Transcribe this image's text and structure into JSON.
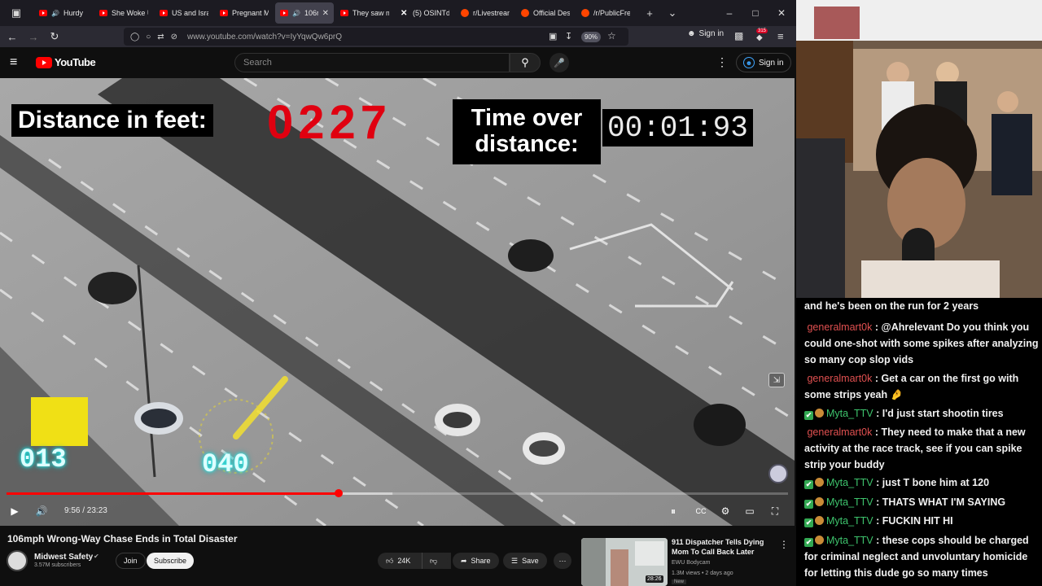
{
  "browser": {
    "tabs": [
      {
        "label": "Hurdy",
        "favicon": "youtube",
        "muted_icon": true,
        "active": false
      },
      {
        "label": "She Woke U",
        "favicon": "youtube",
        "active": false
      },
      {
        "label": "US and Isra",
        "favicon": "youtube",
        "active": false
      },
      {
        "label": "Pregnant M",
        "favicon": "youtube",
        "active": false
      },
      {
        "label": "106r",
        "favicon": "youtube",
        "muted_icon": true,
        "active": true
      },
      {
        "label": "They saw m",
        "favicon": "youtube",
        "active": false
      },
      {
        "label": "(5) OSINTde",
        "favicon": "x",
        "active": false
      },
      {
        "label": "r/Livestrean",
        "favicon": "reddit",
        "active": false
      },
      {
        "label": "Official Des",
        "favicon": "reddit",
        "active": false
      },
      {
        "label": "/r/PublicFre",
        "favicon": "reddit",
        "active": false
      }
    ],
    "url": "www.youtube.com/watch?v=IyYqwQw6prQ",
    "zoom": "90%",
    "signin_label": "Sign in",
    "extension_badge": "315"
  },
  "youtube": {
    "logo_text": "YouTube",
    "search_placeholder": "Search",
    "signin_label": "Sign in",
    "video": {
      "overlay_distance_label": "Distance in feet:",
      "overlay_distance_value": "0227",
      "overlay_time_label": "Time over distance:",
      "overlay_time_value": "00:01:93",
      "speed_left": "013",
      "speed_right": "040",
      "time_display": "9:56 / 23:23",
      "progress_fraction": 0.425,
      "buffered_fraction": 0.494
    },
    "title": "106mph Wrong-Way Chase Ends in Total Disaster",
    "channel": {
      "name": "Midwest Safety",
      "subscribers": "3.57M subscribers",
      "join_label": "Join",
      "subscribe_label": "Subscribe"
    },
    "actions": {
      "likes": "24K",
      "share_label": "Share",
      "save_label": "Save"
    },
    "suggested": {
      "title": "911 Dispatcher Tells Dying Mom To Call Back Later",
      "channel": "EWU Bodycam",
      "meta": "1.3M views • 2 days ago",
      "badge": "New",
      "duration": "28:26"
    }
  },
  "chat": {
    "lines": [
      {
        "user": "",
        "text": "and he's been on the run for 2 years"
      },
      {
        "user": "generalmart0k",
        "badges": false,
        "text": "@Ahrelevant Do you think you could one-shot with some spikes after analyzing so many cop slop vids"
      },
      {
        "user": "generalmart0k",
        "badges": false,
        "text": "Get a car on the first go with some strips yeah 🤌"
      },
      {
        "user": "Myta_TTV",
        "badges": true,
        "text": "I'd just start shootin tires"
      },
      {
        "user": "generalmart0k",
        "badges": false,
        "text": "They need to make that a new activity at the race track, see if you can spike strip your buddy"
      },
      {
        "user": "Myta_TTV",
        "badges": true,
        "text": "just T bone him at 120"
      },
      {
        "user": "Myta_TTV",
        "badges": true,
        "text": "THATS WHAT I'M SAYING"
      },
      {
        "user": "Myta_TTV",
        "badges": true,
        "text": "FUCKIN HIT HI"
      },
      {
        "user": "Myta_TTV",
        "badges": true,
        "text": "these cops should be charged for criminal neglect and unvoluntary homicide for letting this dude go so many times"
      }
    ]
  },
  "colors": {
    "youtube_red": "#ff0000",
    "progress_red": "#ff0000",
    "chat_red_user": "#e05050",
    "chat_green_user": "#3ec46d",
    "distance_red": "#e00010"
  }
}
